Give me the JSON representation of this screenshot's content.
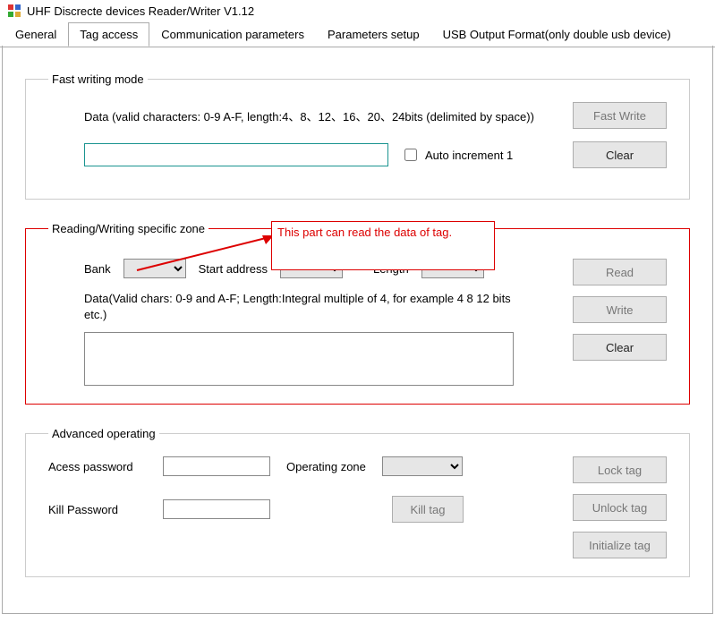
{
  "window": {
    "title": "UHF Discrecte devices Reader/Writer V1.12"
  },
  "tabs": {
    "general": "General",
    "tag_access": "Tag access",
    "comm": "Communication parameters",
    "params": "Parameters setup",
    "usb": "USB Output Format(only double usb device)"
  },
  "annotation": {
    "text": "This part can read the data of tag."
  },
  "fast": {
    "legend": "Fast writing mode",
    "hint": "Data (valid characters: 0-9 A-F, length:4、8、12、16、20、24bits (delimited by space))",
    "input_value": "",
    "auto_inc_label": "Auto increment 1",
    "btn_fast_write": "Fast Write",
    "btn_clear": "Clear"
  },
  "zone": {
    "legend": "Reading/Writing specific zone",
    "label_bank": "Bank",
    "label_start": "Start address",
    "label_length": "Length",
    "data_hint": "Data(Valid chars: 0-9 and A-F; Length:Integral multiple of 4, for example 4 8 12 bits etc.)",
    "data_value": "",
    "btn_read": "Read",
    "btn_write": "Write",
    "btn_clear": "Clear"
  },
  "adv": {
    "legend": "Advanced operating",
    "label_access_pw": "Acess password",
    "access_pw_value": "",
    "label_op_zone": "Operating zone",
    "label_kill_pw": "Kill Password",
    "kill_pw_value": "",
    "btn_kill": "Kill tag",
    "btn_lock": "Lock tag",
    "btn_unlock": "Unlock tag",
    "btn_init": "Initialize tag"
  }
}
